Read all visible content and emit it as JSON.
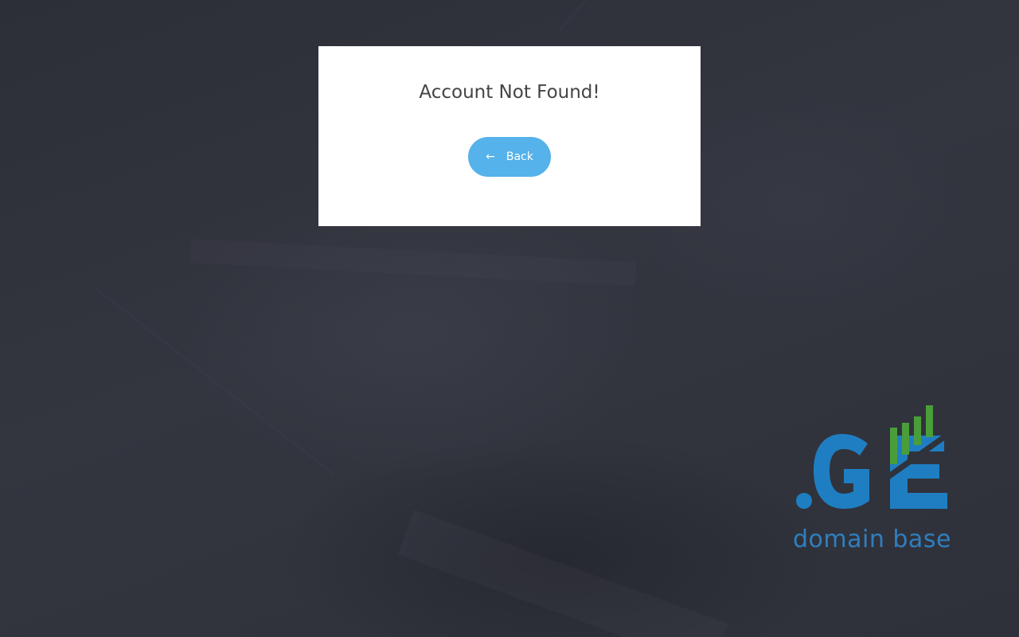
{
  "modal": {
    "title": "Account Not Found!",
    "back_button": {
      "icon": "arrow-left-icon",
      "arrow": "←",
      "label": "Back"
    }
  },
  "brand": {
    "logo_text": ".GE",
    "tagline": "domain base",
    "colors": {
      "blue": "#1f7ec2",
      "green": "#4a9e3a"
    }
  },
  "colors": {
    "background": "#30323c",
    "modal_background": "#ffffff",
    "button": "#55b2ea",
    "title_text": "#444444"
  }
}
